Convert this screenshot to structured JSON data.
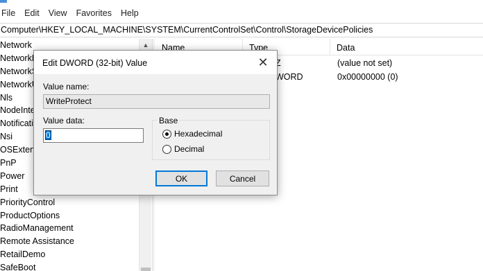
{
  "menu": [
    "File",
    "Edit",
    "View",
    "Favorites",
    "Help"
  ],
  "address": "Computer\\HKEY_LOCAL_MACHINE\\SYSTEM\\CurrentControlSet\\Control\\StorageDevicePolicies",
  "tree": {
    "items": [
      "Network",
      "NetworkP",
      "NetworkS",
      "NetworkU",
      "Nls",
      "NodeInter",
      "Notificatio",
      "Nsi",
      "OSExtensi",
      "PnP",
      "Power",
      "Print",
      "PriorityControl",
      "ProductOptions",
      "RadioManagement",
      "Remote Assistance",
      "RetailDemo",
      "SafeBoot"
    ]
  },
  "list": {
    "headers": {
      "name": "Name",
      "type": "Type",
      "data": "Data"
    },
    "rows": [
      {
        "name": "",
        "type": "Z",
        "data": "(value not set)"
      },
      {
        "name": "",
        "type": "WORD",
        "data": "0x00000000 (0)"
      }
    ]
  },
  "dialog": {
    "title": "Edit DWORD (32-bit) Value",
    "close": "✕",
    "value_name_label": "Value name:",
    "value_name": "WriteProtect",
    "value_data_label": "Value data:",
    "value_data": "0",
    "base_label": "Base",
    "hex_label": "Hexadecimal",
    "dec_label": "Decimal",
    "selected_base": "Hexadecimal",
    "ok_label": "OK",
    "cancel_label": "Cancel"
  },
  "icons": {
    "scroll_up": "▲"
  }
}
